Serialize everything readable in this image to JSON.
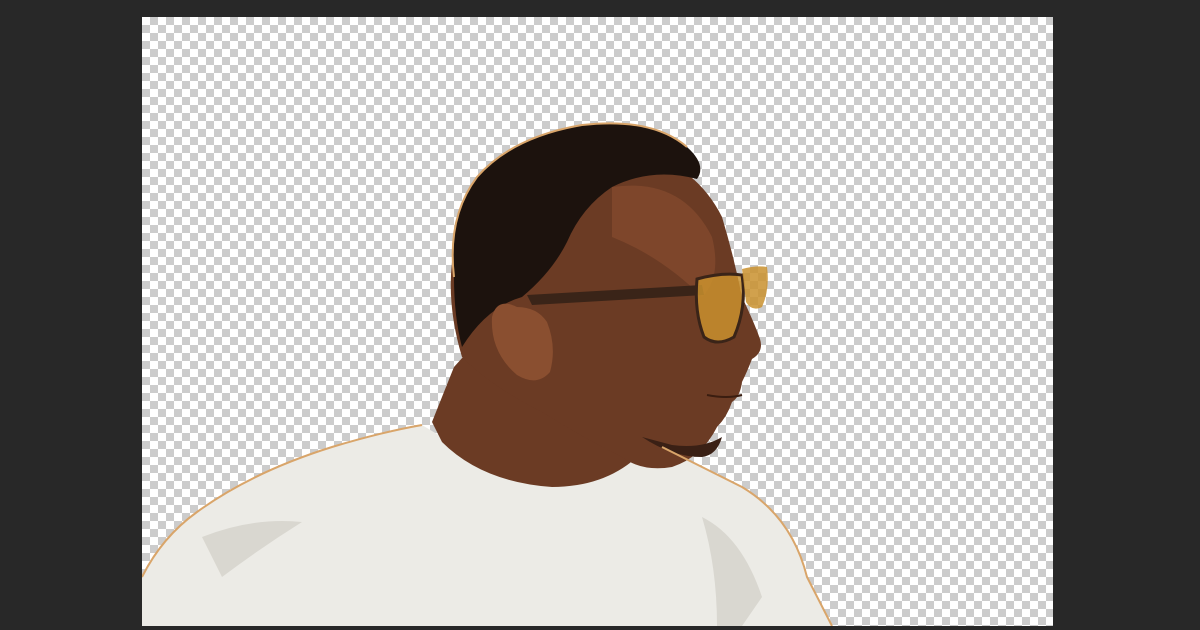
{
  "app": {
    "workspace_color": "#282828"
  },
  "canvas": {
    "transparency_pattern": "checkerboard",
    "checker_light": "#ffffff",
    "checker_dark": "#cccccc"
  },
  "layer": {
    "subject": "person-profile-cutout",
    "colors": {
      "skin": "#6b3b24",
      "skin_highlight": "#8a4f30",
      "hair": "#1c120d",
      "shirt": "#ecebe6",
      "shirt_shadow": "#d9d7d0",
      "glasses_frame": "#3a2418",
      "glasses_lens": "#c9912e",
      "edge_fringe": "#d9a56a"
    }
  }
}
